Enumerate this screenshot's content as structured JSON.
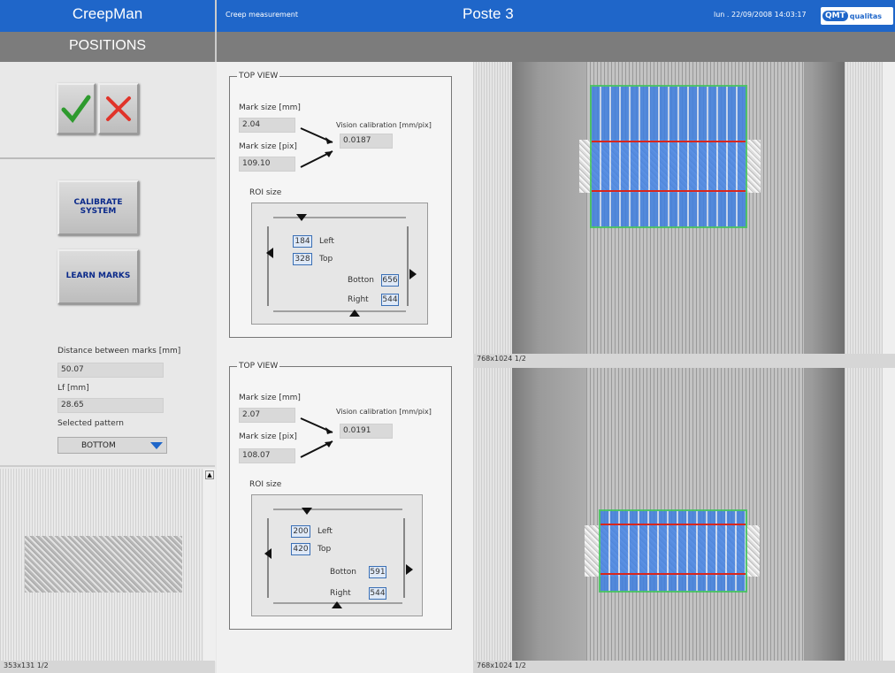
{
  "header": {
    "app_title": "CreepMan",
    "section_title": "Creep measurement",
    "station": "Poste 3",
    "datetime": "lun . 22/09/2008 14:03:17",
    "logo_text": "qualitas"
  },
  "subheader": {
    "title": "POSITIONS"
  },
  "left": {
    "calibrate_label": "CALIBRATE SYSTEM",
    "learn_label": "LEARN MARKS",
    "distance_label": "Distance between marks [mm]",
    "distance_value": "50.07",
    "lf_label": "Lf [mm]",
    "lf_value": "28.65",
    "pattern_label": "Selected pattern",
    "pattern_value": "BOTTOM",
    "thumb_status": "353x131 1/2"
  },
  "views": [
    {
      "legend": "TOP VIEW",
      "mark_mm_label": "Mark size [mm]",
      "mark_mm": "2.04",
      "mark_pix_label": "Mark size [pix]",
      "mark_pix": "109.10",
      "calib_label": "Vision calibration [mm/pix]",
      "calib": "0.0187",
      "roi_label": "ROI size",
      "left_val": "184",
      "left_label": "Left",
      "top_val": "328",
      "top_label": "Top",
      "bottom_label": "Botton",
      "bottom_val": "656",
      "right_label": "Right",
      "right_val": "544"
    },
    {
      "legend": "TOP VIEW",
      "mark_mm_label": "Mark size [mm]",
      "mark_mm": "2.07",
      "mark_pix_label": "Mark size [pix]",
      "mark_pix": "108.07",
      "calib_label": "Vision calibration [mm/pix]",
      "calib": "0.0191",
      "roi_label": "ROI size",
      "left_val": "200",
      "left_label": "Left",
      "top_val": "420",
      "top_label": "Top",
      "bottom_label": "Botton",
      "bottom_val": "591",
      "right_label": "Right",
      "right_val": "544"
    }
  ],
  "cameras": [
    {
      "status": "768x1024 1/2"
    },
    {
      "status": "768x1024 1/2"
    }
  ],
  "colors": {
    "header_blue": "#1f66c9",
    "subheader_grey": "#7c7c7c",
    "roi_blue": "#3f7fe0",
    "roi_green": "#3fc35c",
    "mark_red": "#d9261c"
  },
  "icons": [
    "check-icon",
    "cross-icon",
    "dropdown-arrow-icon",
    "scroll-arrow-icon"
  ]
}
